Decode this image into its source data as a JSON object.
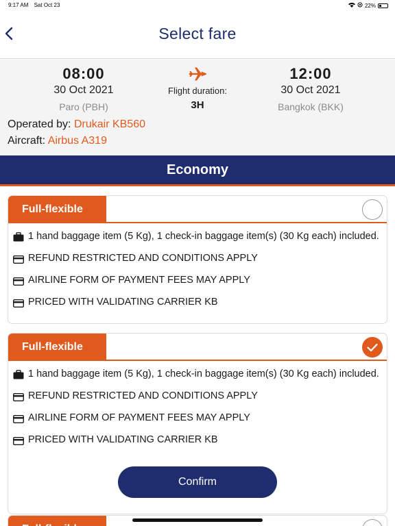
{
  "status_bar": {
    "time": "9:17 AM",
    "date": "Sat Oct 23",
    "battery": "22%"
  },
  "header": {
    "title": "Select fare"
  },
  "flight": {
    "departure": {
      "time": "08:00",
      "date": "30 Oct 2021",
      "airport": "Paro (PBH)"
    },
    "duration_label": "Flight duration:",
    "duration": "3H",
    "arrival": {
      "time": "12:00",
      "date": "30 Oct 2021",
      "airport": "Bangkok (BKK)"
    },
    "operated_label": "Operated by:",
    "operated_value": "Drukair KB560",
    "aircraft_label": "Aircraft:",
    "aircraft_value": "Airbus A319"
  },
  "cabin": {
    "title": "Economy"
  },
  "fares": [
    {
      "name": "Full-flexible",
      "selected": false,
      "items": [
        {
          "icon": "briefcase-icon",
          "text": "1 hand baggage item (5 Kg), 1 check-in baggage item(s) (30 Kg each) included."
        },
        {
          "icon": "card-icon",
          "text": "REFUND RESTRICTED AND CONDITIONS APPLY"
        },
        {
          "icon": "card-icon",
          "text": "AIRLINE FORM OF PAYMENT FEES MAY APPLY"
        },
        {
          "icon": "card-icon",
          "text": "PRICED WITH VALIDATING CARRIER  KB"
        }
      ]
    },
    {
      "name": "Full-flexible",
      "selected": true,
      "items": [
        {
          "icon": "briefcase-icon",
          "text": "1 hand baggage item (5 Kg), 1 check-in baggage item(s) (30 Kg each) included."
        },
        {
          "icon": "card-icon",
          "text": "REFUND RESTRICTED AND CONDITIONS APPLY"
        },
        {
          "icon": "card-icon",
          "text": "AIRLINE FORM OF PAYMENT FEES MAY APPLY"
        },
        {
          "icon": "card-icon",
          "text": "PRICED WITH VALIDATING CARRIER  KB"
        }
      ],
      "confirm_label": "Confirm"
    },
    {
      "name": "Full-flexible",
      "selected": false
    }
  ],
  "colors": {
    "brand_navy": "#1f2d6e",
    "accent_orange": "#e05a1e"
  }
}
